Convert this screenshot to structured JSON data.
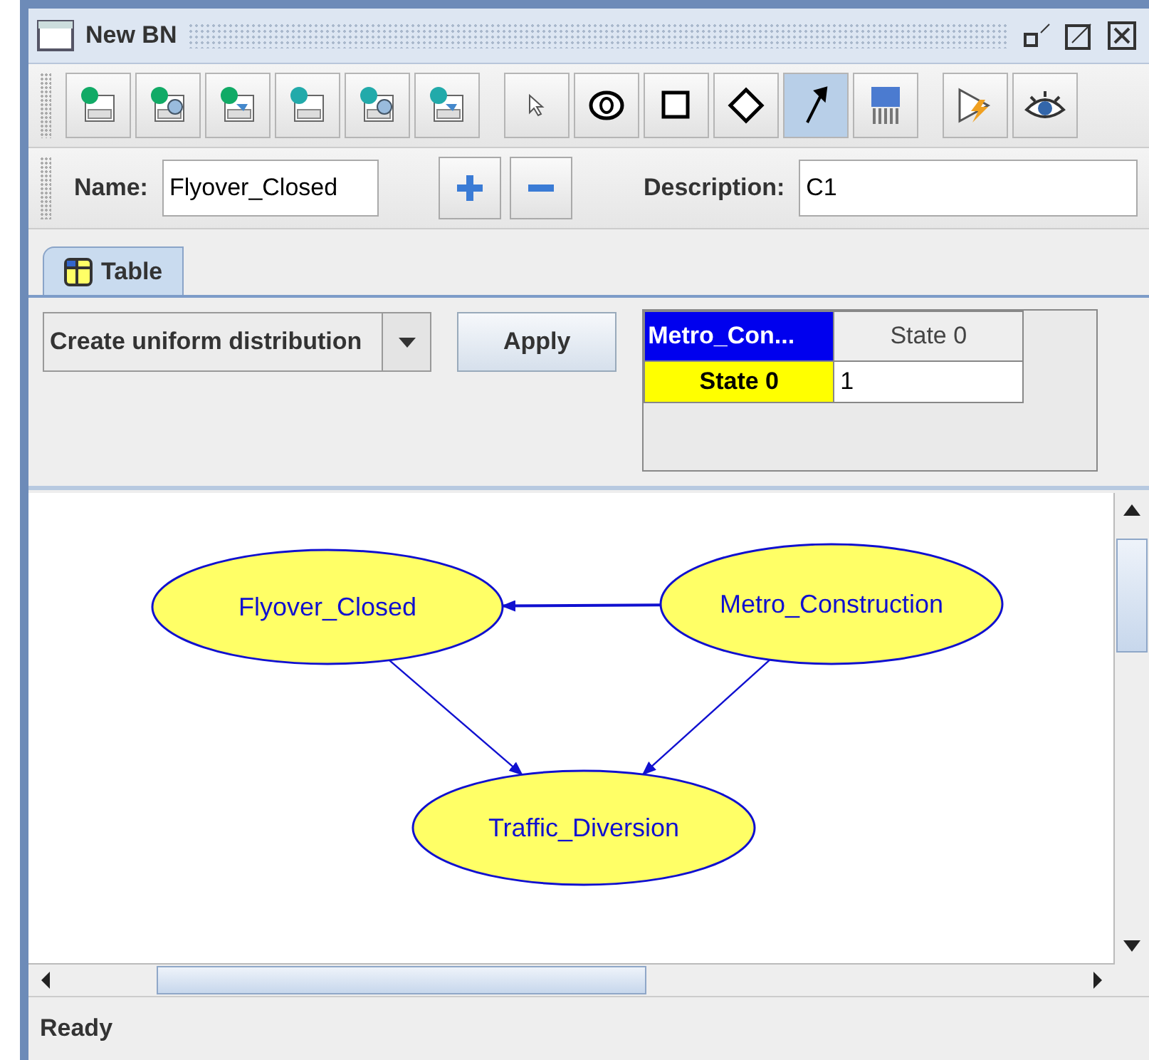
{
  "window": {
    "title": "New BN"
  },
  "toolbar": {
    "tools": [
      {
        "kind": "file-s",
        "selected": false
      },
      {
        "kind": "file-s-search",
        "selected": false
      },
      {
        "kind": "file-s-save",
        "selected": false
      },
      {
        "kind": "file-t",
        "selected": false
      },
      {
        "kind": "file-t-search",
        "selected": false
      },
      {
        "kind": "file-t-save",
        "selected": false
      },
      {
        "kind": "pointer",
        "selected": false
      },
      {
        "kind": "ellipse",
        "selected": false
      },
      {
        "kind": "square",
        "selected": false
      },
      {
        "kind": "diamond",
        "selected": false
      },
      {
        "kind": "arc",
        "selected": true
      },
      {
        "kind": "shredder",
        "selected": false
      },
      {
        "kind": "run",
        "selected": false
      },
      {
        "kind": "eye",
        "selected": false
      }
    ]
  },
  "properties": {
    "name_label": "Name:",
    "name_value": "Flyover_Closed",
    "description_label": "Description:",
    "description_value": "C1"
  },
  "tabs": [
    {
      "label": "Table",
      "selected": true
    }
  ],
  "table_panel": {
    "action": "Create uniform distribution",
    "apply": "Apply",
    "table": {
      "corner": "Metro_Con...",
      "columns": [
        "State 0"
      ],
      "rows": [
        {
          "label": "State 0",
          "cells": [
            "1"
          ]
        }
      ]
    }
  },
  "graph": {
    "nodes": [
      {
        "label": "Flyover_Closed"
      },
      {
        "label": "Metro_Construction"
      },
      {
        "label": "Traffic_Diversion"
      }
    ]
  },
  "status_bar": "Ready"
}
